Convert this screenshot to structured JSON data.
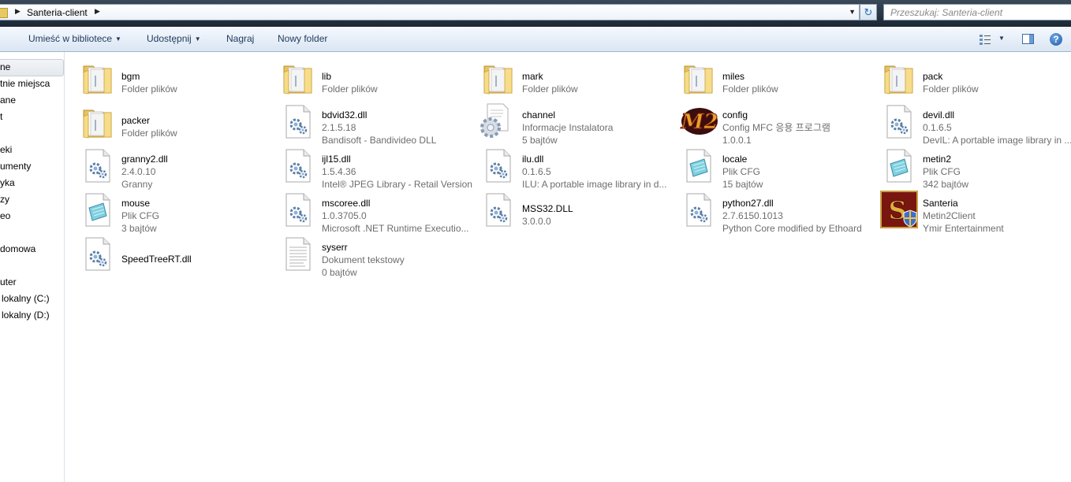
{
  "address": {
    "crumb": "Santeria-client"
  },
  "search": {
    "placeholder": "Przeszukaj: Santeria-client"
  },
  "toolbar": {
    "library": "Umieść w bibliotece",
    "share": "Udostępnij",
    "burn": "Nagraj",
    "new_folder": "Nowy folder"
  },
  "nav": {
    "items": [
      "ne",
      "tnie miejsca",
      "ane",
      "t",
      "eki",
      "umenty",
      "yka",
      "zy",
      "eo",
      "domowa",
      "uter",
      "lokalny (C:)",
      "lokalny (D:)"
    ]
  },
  "files": [
    {
      "name": "bgm",
      "l2": "Folder plików",
      "l3": "",
      "icon": "folder"
    },
    {
      "name": "lib",
      "l2": "Folder plików",
      "l3": "",
      "icon": "folder"
    },
    {
      "name": "mark",
      "l2": "Folder plików",
      "l3": "",
      "icon": "folder"
    },
    {
      "name": "miles",
      "l2": "Folder plików",
      "l3": "",
      "icon": "folder"
    },
    {
      "name": "pack",
      "l2": "Folder plików",
      "l3": "",
      "icon": "folder"
    },
    {
      "name": "packer",
      "l2": "Folder plików",
      "l3": "",
      "icon": "folder"
    },
    {
      "name": "bdvid32.dll",
      "l2": "2.1.5.18",
      "l3": "Bandisoft - Bandivideo DLL",
      "icon": "dll"
    },
    {
      "name": "channel",
      "l2": "Informacje Instalatora",
      "l3": "5 bajtów",
      "icon": "setup"
    },
    {
      "name": "config",
      "l2": "Config MFC 응용 프로그램",
      "l3": "1.0.0.1",
      "icon": "m2"
    },
    {
      "name": "devil.dll",
      "l2": "0.1.6.5",
      "l3": "DevIL: A portable image library in ...",
      "icon": "dll"
    },
    {
      "name": "granny2.dll",
      "l2": "2.4.0.10",
      "l3": "Granny",
      "icon": "dll"
    },
    {
      "name": "ijl15.dll",
      "l2": "1.5.4.36",
      "l3": "Intel® JPEG Library - Retail Version",
      "icon": "dll"
    },
    {
      "name": "ilu.dll",
      "l2": "0.1.6.5",
      "l3": "ILU: A portable image library in d...",
      "icon": "dll"
    },
    {
      "name": "locale",
      "l2": "Plik CFG",
      "l3": "15 bajtów",
      "icon": "cfg"
    },
    {
      "name": "metin2",
      "l2": "Plik CFG",
      "l3": "342 bajtów",
      "icon": "cfg"
    },
    {
      "name": "mouse",
      "l2": "Plik CFG",
      "l3": "3 bajtów",
      "icon": "cfg"
    },
    {
      "name": "mscoree.dll",
      "l2": "1.0.3705.0",
      "l3": "Microsoft .NET Runtime Executio...",
      "icon": "dll"
    },
    {
      "name": "MSS32.DLL",
      "l2": "3.0.0.0",
      "l3": "",
      "icon": "dll"
    },
    {
      "name": "python27.dll",
      "l2": "2.7.6150.1013",
      "l3": "Python Core modified by Ethoard",
      "icon": "dll"
    },
    {
      "name": "Santeria",
      "l2": "Metin2Client",
      "l3": "Ymir Entertainment",
      "icon": "santeria"
    },
    {
      "name": "SpeedTreeRT.dll",
      "l2": "",
      "l3": "",
      "icon": "dll"
    },
    {
      "name": "syserr",
      "l2": "Dokument tekstowy",
      "l3": "0 bajtów",
      "icon": "txt"
    }
  ]
}
